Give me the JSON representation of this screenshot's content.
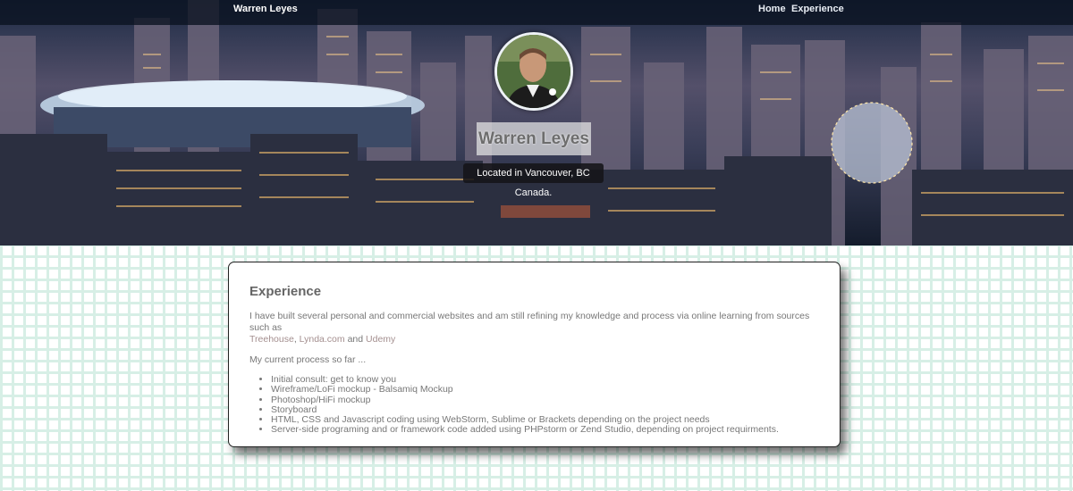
{
  "navbar": {
    "brand": "Warren Leyes",
    "links": [
      "Home",
      "Experience"
    ]
  },
  "hero": {
    "name": "Warren Leyes",
    "location": "Located in Vancouver, BC Canada."
  },
  "experience": {
    "title": "Experience",
    "intro_text": "I have built several personal and commercial websites and am still refining my knowledge and process via online learning from sources such as",
    "links": {
      "treehouse": "Treehouse",
      "lynda": "Lynda.com",
      "udemy": "Udemy"
    },
    "separator_comma": ",",
    "separator_and": "and",
    "process_heading": "My current process so far ...",
    "process_items": [
      "Initial consult: get to know you",
      "Wireframe/LoFi mockup - Balsamiq Mockup",
      "Photoshop/HiFi mockup",
      "Storyboard",
      "HTML, CSS and Javascript coding using WebStorm, Sublime or Brackets depending on the project needs",
      "Server-side programing and or framework code added using PHPstorm or Zend Studio, depending on project requirments."
    ]
  },
  "colors": {
    "navbar_bg": "#0a1220",
    "grid_line": "#d7efe6",
    "link": "#a48f8f",
    "text": "#777777"
  }
}
